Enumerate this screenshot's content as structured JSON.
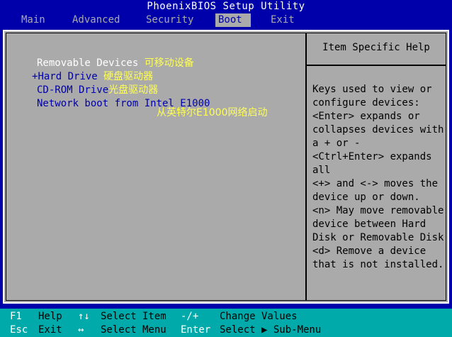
{
  "title": "PhoenixBIOS Setup Utility",
  "menu": [
    {
      "label": "Main"
    },
    {
      "label": "Advanced"
    },
    {
      "label": "Security"
    },
    {
      "label": "Boot"
    },
    {
      "label": "Exit"
    }
  ],
  "active_menu": "Boot",
  "boot_items": [
    {
      "prefix": "",
      "label": "Removable Devices",
      "annotation": "可移动设备"
    },
    {
      "prefix": "+",
      "label": "Hard Drive",
      "annotation": "硬盘驱动器"
    },
    {
      "prefix": "",
      "label": "CD-ROM Drive",
      "annotation": "光盘驱动器"
    },
    {
      "prefix": "",
      "label": "Network boot from Intel E1000",
      "annotation": "从英特尔E1000网络启动"
    }
  ],
  "help": {
    "title": "Item Specific Help",
    "text": "Keys used to view or\nconfigure devices:\n<Enter> expands or\ncollapses devices with\na + or -\n<Ctrl+Enter> expands\nall\n<+> and <-> moves the\ndevice up or down.\n<n> May move removable\ndevice between Hard\nDisk or Removable Disk\n<d> Remove a device\nthat is not installed."
  },
  "footer": {
    "row1": [
      {
        "key": "F1",
        "desc": "Help"
      },
      {
        "key": "↑↓",
        "desc": "Select Item"
      },
      {
        "key": "-/+",
        "desc": "Change Values"
      }
    ],
    "row2": [
      {
        "key": "Esc",
        "desc": "Exit"
      },
      {
        "key": "↔",
        "desc": "Select Menu"
      },
      {
        "key": "Enter",
        "desc": "Select ▶ Sub-Menu"
      }
    ]
  },
  "colors": {
    "background": "#0000aa",
    "panel": "#aaaaaa",
    "footer": "#00aaaa",
    "highlight_text": "#ffffff",
    "annotation": "#ffff55"
  }
}
